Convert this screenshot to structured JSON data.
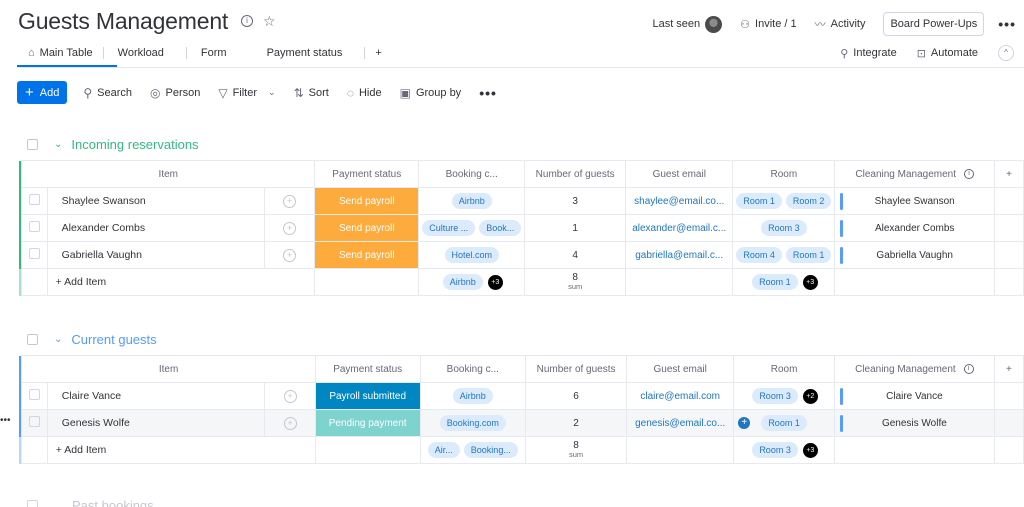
{
  "header": {
    "title": "Guests Management",
    "last_seen_label": "Last seen",
    "invite_label": "Invite / 1",
    "activity_label": "Activity",
    "power_ups_label": "Board Power-Ups",
    "more": "•••"
  },
  "tabs": [
    {
      "label": "Main Table",
      "icon": "home-icon",
      "active": true
    },
    {
      "label": "Workload"
    },
    {
      "label": "Form"
    },
    {
      "label": "Payment status"
    },
    {
      "label": "+"
    }
  ],
  "actions": {
    "integrate_label": "Integrate",
    "automate_label": "Automate",
    "collapse": "^"
  },
  "toolbar": {
    "add_label": "Add",
    "search_label": "Search",
    "person_label": "Person",
    "filter_label": "Filter",
    "sort_label": "Sort",
    "hide_label": "Hide",
    "group_by_label": "Group by",
    "more": "•••"
  },
  "columns": {
    "item": "Item",
    "payment_status": "Payment status",
    "booking": "Booking c...",
    "guests": "Number of guests",
    "email": "Guest email",
    "room": "Room",
    "cleaning": "Cleaning Management",
    "add": "+"
  },
  "groups": [
    {
      "title": "Incoming reservations",
      "color": "#33b97e",
      "rows": [
        {
          "name": "Shaylee Swanson",
          "status": "Send payroll",
          "status_color": "#fdab3d",
          "booking": [
            "Airbnb"
          ],
          "guests": "3",
          "email": "shaylee@email.co...",
          "rooms": [
            "Room 1",
            "Room 2"
          ],
          "cleaning": "Shaylee Swanson"
        },
        {
          "name": "Alexander Combs",
          "status": "Send payroll",
          "status_color": "#fdab3d",
          "booking": [
            "Culture ...",
            "Book..."
          ],
          "guests": "1",
          "email": "alexander@email.c...",
          "rooms": [
            "Room 3"
          ],
          "cleaning": "Alexander Combs"
        },
        {
          "name": "Gabriella Vaughn",
          "status": "Send payroll",
          "status_color": "#fdab3d",
          "booking": [
            "Hotel.com"
          ],
          "guests": "4",
          "email": "gabriella@email.c...",
          "rooms": [
            "Room 4",
            "Room 1"
          ],
          "cleaning": "Gabriella Vaughn"
        }
      ],
      "footer": {
        "add_item": "+ Add Item",
        "booking_summary": "Airbnb",
        "booking_badge": "+3",
        "guests_sum": "8",
        "sum_label": "sum",
        "room_summary": "Room 1",
        "room_badge": "+3"
      }
    },
    {
      "title": "Current guests",
      "color": "#579bfc",
      "rows": [
        {
          "name": "Claire Vance",
          "status": "Payroll submitted",
          "status_color": "#0086c0",
          "booking": [
            "Airbnb"
          ],
          "guests": "6",
          "email": "claire@email.com",
          "rooms": [
            "Room 3"
          ],
          "room_badge": "+2",
          "cleaning": "Claire Vance"
        },
        {
          "name": "Genesis Wolfe",
          "status": "Pending payment",
          "status_color": "#7ed3cf",
          "booking": [
            "Booking.com"
          ],
          "guests": "2",
          "email": "genesis@email.co...",
          "rooms": [
            "Room 1"
          ],
          "cleaning": "Genesis Wolfe"
        }
      ],
      "footer": {
        "add_item": "+ Add Item",
        "booking_summary": [
          "Air...",
          "Booking..."
        ],
        "guests_sum": "8",
        "sum_label": "sum",
        "room_summary": "Room 3",
        "room_badge": "+3"
      }
    }
  ],
  "past_group_title": "Past bookings"
}
